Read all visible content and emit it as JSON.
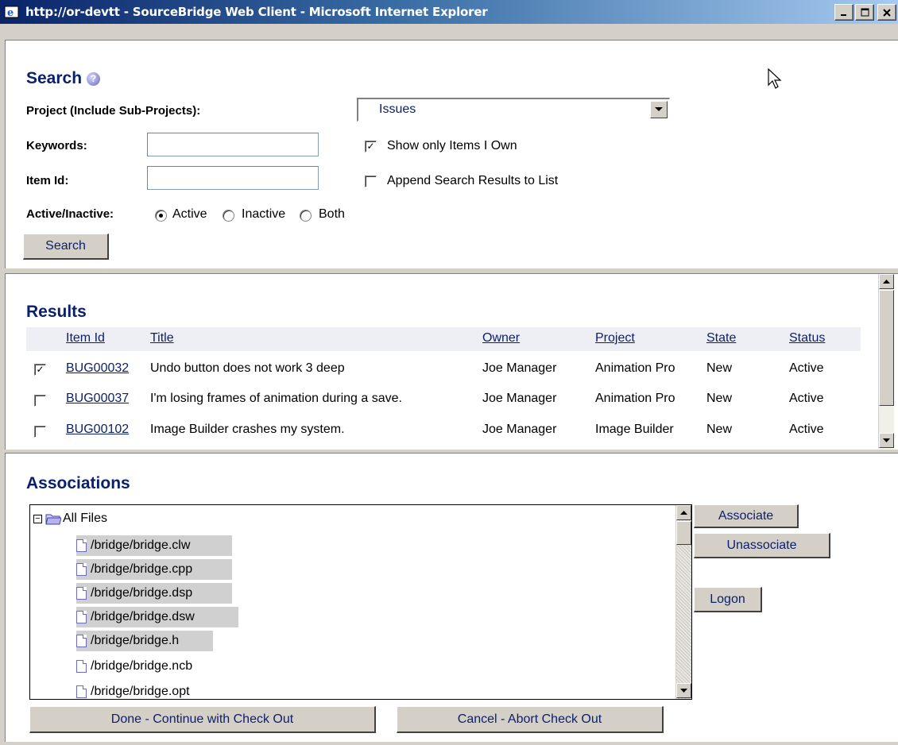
{
  "window": {
    "title": "http://or-devtt - SourceBridge Web Client - Microsoft Internet Explorer",
    "minimize": "_",
    "maximize": "□",
    "close": "×"
  },
  "search": {
    "title": "Search",
    "project_label": "Project (Include Sub-Projects):",
    "project_value": "Issues",
    "keywords_label": "Keywords:",
    "keywords_value": "",
    "itemid_label": "Item Id:",
    "itemid_value": "",
    "show_only_label": "Show only Items I Own",
    "show_only_checked": true,
    "append_label": "Append Search Results to List",
    "append_checked": false,
    "active_label": "Active/Inactive:",
    "radio_active": "Active",
    "radio_inactive": "Inactive",
    "radio_both": "Both",
    "selected_radio": "Active",
    "search_button": "Search"
  },
  "results": {
    "title": "Results",
    "columns": [
      "Item Id",
      "Title",
      "Owner",
      "Project",
      "State",
      "Status"
    ],
    "rows": [
      {
        "checked": true,
        "id": "BUG00032",
        "title": "Undo button does not work 3 deep",
        "owner": "Joe Manager",
        "project": "Animation Pro",
        "state": "New",
        "status": "Active"
      },
      {
        "checked": false,
        "id": "BUG00037",
        "title": "I'm losing frames of animation during a save.",
        "owner": "Joe Manager",
        "project": "Animation Pro",
        "state": "New",
        "status": "Active"
      },
      {
        "checked": false,
        "id": "BUG00102",
        "title": "Image Builder crashes my system.",
        "owner": "Joe Manager",
        "project": "Image Builder",
        "state": "New",
        "status": "Active"
      }
    ]
  },
  "associations": {
    "title": "Associations",
    "root": "All Files",
    "files": [
      {
        "name": "/bridge/bridge.clw",
        "selected": true
      },
      {
        "name": "/bridge/bridge.cpp",
        "selected": true
      },
      {
        "name": "/bridge/bridge.dsp",
        "selected": true
      },
      {
        "name": "/bridge/bridge.dsw",
        "selected": true
      },
      {
        "name": "/bridge/bridge.h",
        "selected": true
      },
      {
        "name": "/bridge/bridge.ncb",
        "selected": false
      },
      {
        "name": "/bridge/bridge.opt",
        "selected": false
      }
    ],
    "associate_button": "Associate",
    "unassociate_button": "Unassociate",
    "logon_button": "Logon",
    "done_button": "Done - Continue with Check Out",
    "cancel_button": "Cancel - Abort Check Out"
  },
  "colors": {
    "heading": "#0a1f6e",
    "window_bg": "#d4d0c8"
  }
}
